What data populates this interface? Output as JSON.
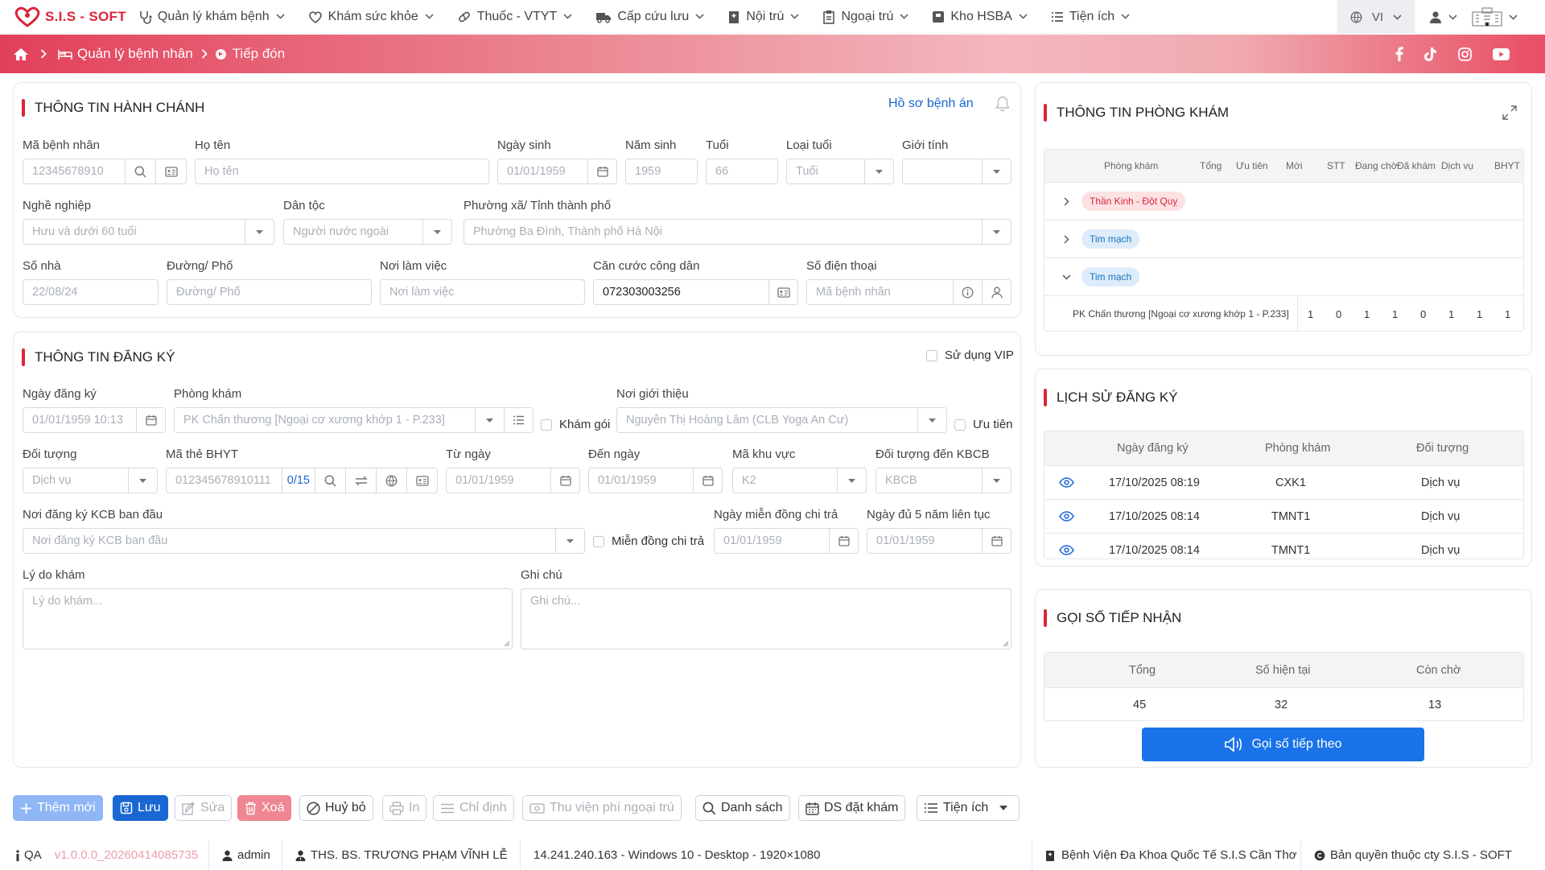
{
  "app": {
    "logo_text": "S.I.S - SOFT",
    "brand_color": "#d9263c",
    "primary_color": "#1967d2"
  },
  "nav": {
    "items": [
      {
        "label": "Quản lý khám bệnh",
        "icon": "stethoscope-icon"
      },
      {
        "label": "Khám sức khỏe",
        "icon": "heart-icon"
      },
      {
        "label": "Thuốc - VTYT",
        "icon": "pill-icon"
      },
      {
        "label": "Cấp cứu lưu",
        "icon": "ambulance-icon"
      },
      {
        "label": "Nội trú",
        "icon": "hospital-icon"
      },
      {
        "label": "Ngoại trú",
        "icon": "clipboard-icon"
      },
      {
        "label": "Kho HSBA",
        "icon": "archive-icon"
      },
      {
        "label": "Tiện ích",
        "icon": "list-icon"
      }
    ],
    "lang": "VI"
  },
  "breadcrumb": {
    "section": "Quản lý bệnh nhân",
    "current": "Tiếp đón"
  },
  "admin": {
    "title": "THÔNG TIN HÀNH CHÁNH",
    "record_link": "Hồ sơ bệnh án",
    "labels": {
      "patient_id": "Mã bệnh nhân",
      "name": "Họ tên",
      "dob": "Ngày sinh",
      "yob": "Năm sinh",
      "age": "Tuổi",
      "age_type": "Loại tuổi",
      "gender": "Giới tính",
      "job": "Nghề nghiệp",
      "ethnic": "Dân tộc",
      "ward": "Phường xã/ Tỉnh thành phố",
      "house": "Số nhà",
      "street": "Đường/ Phố",
      "work": "Nơi làm việc",
      "cccd": "Căn cước công dân",
      "phone": "Số điện thoại"
    },
    "values": {
      "patient_id": "12345678910",
      "name": "Họ tên",
      "dob": "01/01/1959",
      "yob": "1959",
      "age": "66",
      "age_type": "Tuổi",
      "gender": "",
      "job": "Hưu và dưới 60 tuổi",
      "ethnic": "Người nước ngoài",
      "ward": "Phường Ba Đình, Thành phố Hà Nội",
      "house": "22/08/24",
      "street": "Đường/ Phố",
      "work": "Nơi làm việc",
      "cccd": "072303003256",
      "phone": "Mã bệnh nhân"
    }
  },
  "reg": {
    "title": "THÔNG TIN ĐĂNG KÝ",
    "vip": "Sử dụng VIP",
    "labels": {
      "reg_date": "Ngày đăng ký",
      "room": "Phòng khám",
      "referrer": "Nơi giới thiệu",
      "object": "Đối tượng",
      "bhyt": "Mã thẻ BHYT",
      "from": "Từ ngày",
      "to": "Đến ngày",
      "area": "Mã khu vực",
      "kbcb_obj": "Đối tượng đến KBCB",
      "kcb_place": "Nơi đăng ký KCB ban đầu",
      "exempt_date": "Ngày miễn đồng chi trả",
      "five_year": "Ngày đủ 5 năm liên tục",
      "reason": "Lý do khám",
      "note": "Ghi chú"
    },
    "checks": {
      "package": "Khám gói",
      "priority": "Ưu tiên",
      "exempt": "Miễn đồng chi trả"
    },
    "values": {
      "reg_date": "01/01/1959 10:13",
      "room": "PK Chấn thương [Ngoại cơ xương khớp 1 - P.233]",
      "referrer": "Nguyễn Thị Hoàng Lâm (CLB Yoga An Cư)",
      "object": "Dịch vụ",
      "bhyt": "012345678910111",
      "bhyt_count": "0/15",
      "from": "01/01/1959",
      "to": "01/01/1959",
      "area": "K2",
      "kbcb_obj": "KBCB",
      "kcb_place": "Nơi đăng ký KCB ban đầu",
      "exempt_date": "01/01/1959",
      "five_year": "01/01/1959",
      "reason": "Lý do khám...",
      "note": "Ghi chú..."
    }
  },
  "clinic": {
    "title": "THÔNG TIN PHÒNG KHÁM",
    "headers": [
      "Phòng khám",
      "Tổng",
      "Ưu tiên",
      "Mới",
      "STT",
      "Đang chờ",
      "Đã khám",
      "Dịch vụ",
      "BHYT"
    ],
    "groups": [
      {
        "name": "Thần Kinh - Đột Quỵ",
        "color": "#d9263c",
        "bg": "#fde2e4"
      },
      {
        "name": "Tim mạch",
        "color": "#1a73b8",
        "bg": "#dcecfb"
      },
      {
        "name": "Tim mạch",
        "color": "#1a73b8",
        "bg": "#dcecfb"
      }
    ],
    "row": {
      "name": "PK Chấn thương [Ngoại cơ xương khớp 1 - P.233]",
      "values": [
        "1",
        "0",
        "1",
        "1",
        "0",
        "1",
        "1",
        "1"
      ]
    }
  },
  "history": {
    "title": "LỊCH SỬ ĐĂNG KÝ",
    "headers": [
      "Ngày đăng ký",
      "Phòng khám",
      "Đối tượng"
    ],
    "rows": [
      {
        "date": "17/10/2025 08:19",
        "room": "CXK1",
        "obj": "Dịch vụ"
      },
      {
        "date": "17/10/2025 08:14",
        "room": "TMNT1",
        "obj": "Dịch vụ"
      },
      {
        "date": "17/10/2025 08:14",
        "room": "TMNT1",
        "obj": "Dịch vụ"
      }
    ]
  },
  "queue": {
    "title": "GỌI SỐ TIẾP NHẬN",
    "headers": [
      "Tổng",
      "Số hiện tại",
      "Còn chờ"
    ],
    "values": [
      "45",
      "32",
      "13"
    ],
    "call_button": "Gọi số tiếp theo"
  },
  "toolbar": {
    "add": "Thêm mới",
    "save": "Lưu",
    "edit": "Sửa",
    "delete": "Xoá",
    "cancel": "Huỷ bỏ",
    "print": "In",
    "assign": "Chỉ định",
    "fee": "Thu viện phí ngoại trú",
    "list": "Danh sách",
    "booking": "DS đặt khám",
    "utils": "Tiện ích"
  },
  "footer": {
    "env": "QA",
    "version": "v1.0.0.0_20260414085735",
    "user": "admin",
    "doctor": "THS. BS. TRƯƠNG PHẠM VĨNH LỄ",
    "system": "14.241.240.163 - Windows 10 - Desktop - 1920×1080",
    "hospital": "Bệnh Viện Đa Khoa Quốc Tế S.I.S Cần Thơ",
    "copyright": "Bản quyền thuộc cty S.I.S - SOFT"
  }
}
